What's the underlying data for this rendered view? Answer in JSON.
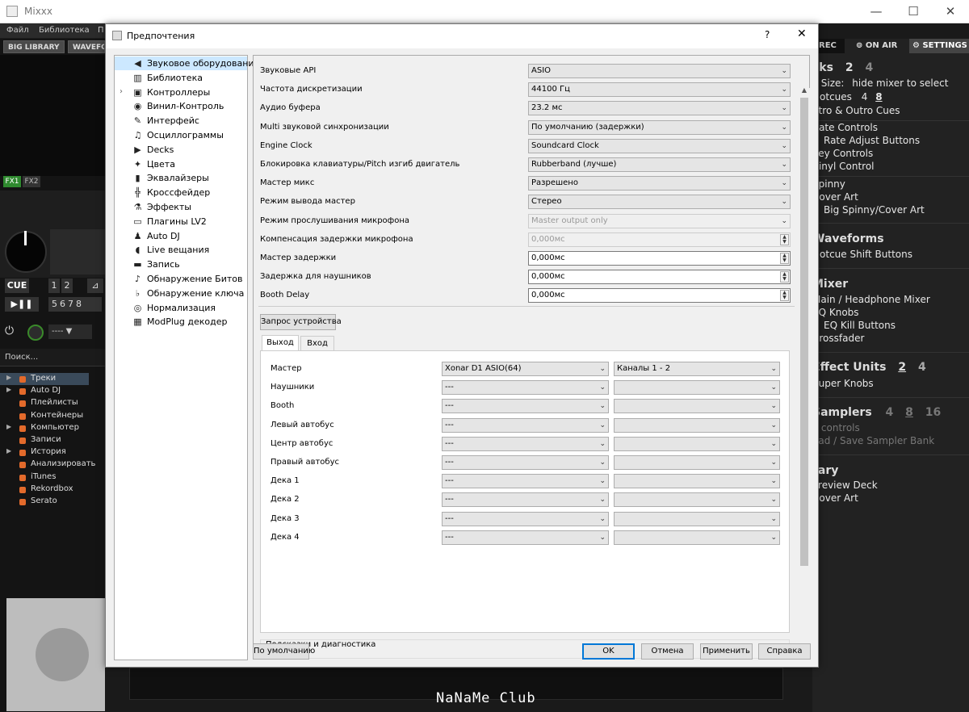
{
  "main_window": {
    "title": "Mixxx",
    "minimize": "—",
    "maximize": "☐",
    "close": "✕"
  },
  "menubar": {
    "items": [
      "Файл",
      "Библиотека",
      "П"
    ]
  },
  "skin_top": {
    "big_library": "BIG LIBRARY",
    "waveform": "WAVEFO",
    "rec": "REC",
    "on_air": "ON AIR",
    "settings": "SETTINGS"
  },
  "skin_left": {
    "fx1": "FX1",
    "fx2": "FX2",
    "cue": "CUE",
    "hotcue_row1": [
      "1",
      "2",
      "⊿"
    ],
    "hotcue_row2": [
      "5",
      "6",
      "7",
      "8"
    ],
    "search_placeholder": "Поиск...",
    "tree": [
      "Треки",
      "Auto DJ",
      "Плейлисты",
      "Контейнеры",
      "Компьютер",
      "Записи",
      "История",
      "Анализировать",
      "iTunes",
      "Rekordbox",
      "Serato"
    ],
    "tree_expandable": [
      true,
      true,
      false,
      false,
      true,
      false,
      true,
      false,
      false,
      false,
      false
    ]
  },
  "skin_right": {
    "decks_head": "cks",
    "decks_n2": "2",
    "decks_n4": "4",
    "deck_size": "k Size:",
    "hide_mixer": "hide mixer to select",
    "hotcues": "Hotcues",
    "hotcues_4": "4",
    "hotcues_8": "8",
    "intro_outro": "ntro & Outro Cues",
    "rate_controls": "Rate Controls",
    "rate_adjust": "Rate Adjust Buttons",
    "key_controls": "Key Controls",
    "vinyl_control": "Vinyl Control",
    "spinny": "Spinny",
    "cover_art": "Cover Art",
    "big_spinny": "Big Spinny/Cover Art",
    "waveforms_head": "Waveforms",
    "hotcue_shift": "Hotcue Shift Buttons",
    "mixer_head": "Mixer",
    "main_headphone": "Main / Headphone Mixer",
    "eq_knobs": "EQ Knobs",
    "eq_kill": "EQ Kill Buttons",
    "crossfader": "Crossfader",
    "effect_units_head": "Effect Units",
    "eu_2": "2",
    "eu_4": "4",
    "super_knobs": "Super Knobs",
    "samplers_head": "Samplers",
    "s_4": "4",
    "s_8": "8",
    "s_16": "16",
    "fx_controls": "x controls",
    "load_save": "oad / Save Sampler Bank",
    "library_head": "rary",
    "preview_deck": "Preview Deck",
    "lib_cover_art": "Cover Art"
  },
  "dialog": {
    "title": "Предпочтения",
    "help": "?",
    "close": "✕",
    "nav": [
      {
        "label": "Звуковое оборудование",
        "icon": "speaker-icon",
        "glyph": "◀"
      },
      {
        "label": "Библиотека",
        "icon": "library-icon",
        "glyph": "▥"
      },
      {
        "label": "Контроллеры",
        "icon": "controller-icon",
        "glyph": "▣"
      },
      {
        "label": "Винил-Контроль",
        "icon": "vinyl-icon",
        "glyph": "◉"
      },
      {
        "label": "Интерфейс",
        "icon": "interface-icon",
        "glyph": "✎"
      },
      {
        "label": "Осциллограммы",
        "icon": "waveform-icon",
        "glyph": "♫"
      },
      {
        "label": "Decks",
        "icon": "play-icon",
        "glyph": "▶"
      },
      {
        "label": "Цвета",
        "icon": "color-icon",
        "glyph": "✦"
      },
      {
        "label": "Эквалайзеры",
        "icon": "equalizer-icon",
        "glyph": "▮"
      },
      {
        "label": "Кроссфейдер",
        "icon": "crossfader-icon",
        "glyph": "╬"
      },
      {
        "label": "Эффекты",
        "icon": "effects-icon",
        "glyph": "⚗"
      },
      {
        "label": "Плагины LV2",
        "icon": "lv2-icon",
        "glyph": "▭"
      },
      {
        "label": "Auto DJ",
        "icon": "autodj-icon",
        "glyph": "♟"
      },
      {
        "label": "Live вещания",
        "icon": "broadcast-icon",
        "glyph": "◖"
      },
      {
        "label": "Запись",
        "icon": "record-icon",
        "glyph": "▬"
      },
      {
        "label": "Обнаружение Битов",
        "icon": "beat-icon",
        "glyph": "♪"
      },
      {
        "label": "Обнаружение ключа",
        "icon": "key-icon",
        "glyph": "♭"
      },
      {
        "label": "Нормализация",
        "icon": "normalize-icon",
        "glyph": "◎"
      },
      {
        "label": "ModPlug декодер",
        "icon": "modplug-icon",
        "glyph": "▦"
      }
    ],
    "form": [
      {
        "label": "Звуковые API",
        "value": "ASIO",
        "kind": "combo"
      },
      {
        "label": "Частота дискретизации",
        "value": "44100 Гц",
        "kind": "combo"
      },
      {
        "label": "Аудио буфера",
        "value": "23.2 мс",
        "kind": "combo"
      },
      {
        "label": "Multi звуковой синхронизации",
        "value": "По умолчанию (задержки)",
        "kind": "combo"
      },
      {
        "label": "Engine Clock",
        "value": "Soundcard Clock",
        "kind": "combo"
      },
      {
        "label": "Блокировка клавиатуры/Pitch изгиб двигатель",
        "value": "Rubberband (лучше)",
        "kind": "combo"
      },
      {
        "label": "Мастер микс",
        "value": "Разрешено",
        "kind": "combo"
      },
      {
        "label": "Режим вывода мастер",
        "value": "Стерео",
        "kind": "combo"
      },
      {
        "label": "Режим прослушивания микрофона",
        "value": "Master output only",
        "kind": "combo-disabled"
      },
      {
        "label": "Компенсация задержки микрофона",
        "value": "0,000мс",
        "kind": "spin-disabled"
      },
      {
        "label": "Мастер задержки",
        "value": "0,000мс",
        "kind": "spin"
      },
      {
        "label": "Задержка для наушников",
        "value": "0,000мс",
        "kind": "spin"
      },
      {
        "label": "Booth Delay",
        "value": "0,000мс",
        "kind": "spin"
      }
    ],
    "query_button": "Запрос устройства",
    "tabs": [
      "Выход",
      "Вход"
    ],
    "outputs": [
      {
        "label": "Мастер",
        "device": "Xonar D1 ASIO(64)",
        "channels": "Каналы 1 - 2"
      },
      {
        "label": "Наушники",
        "device": "---",
        "channels": ""
      },
      {
        "label": "Booth",
        "device": "---",
        "channels": ""
      },
      {
        "label": "Левый автобус",
        "device": "---",
        "channels": ""
      },
      {
        "label": "Центр автобус",
        "device": "---",
        "channels": ""
      },
      {
        "label": "Правый автобус",
        "device": "---",
        "channels": ""
      },
      {
        "label": "Дека 1",
        "device": "---",
        "channels": ""
      },
      {
        "label": "Дека 2",
        "device": "---",
        "channels": ""
      },
      {
        "label": "Дека 3",
        "device": "---",
        "channels": ""
      },
      {
        "label": "Дека 4",
        "device": "---",
        "channels": ""
      }
    ],
    "hints_title": "Подсказки и диагностика",
    "buttons": {
      "defaults": "По умолчанию",
      "ok": "OK",
      "cancel": "Отмена",
      "apply": "Применить",
      "help": "Справка"
    }
  },
  "watermark": "NaNaMe Club",
  "colors": {
    "accent_selected": "#cce8ff",
    "default_button_border": "#0078d7",
    "skin_bg": "#222222",
    "tree_icon": "#e36a2b"
  }
}
